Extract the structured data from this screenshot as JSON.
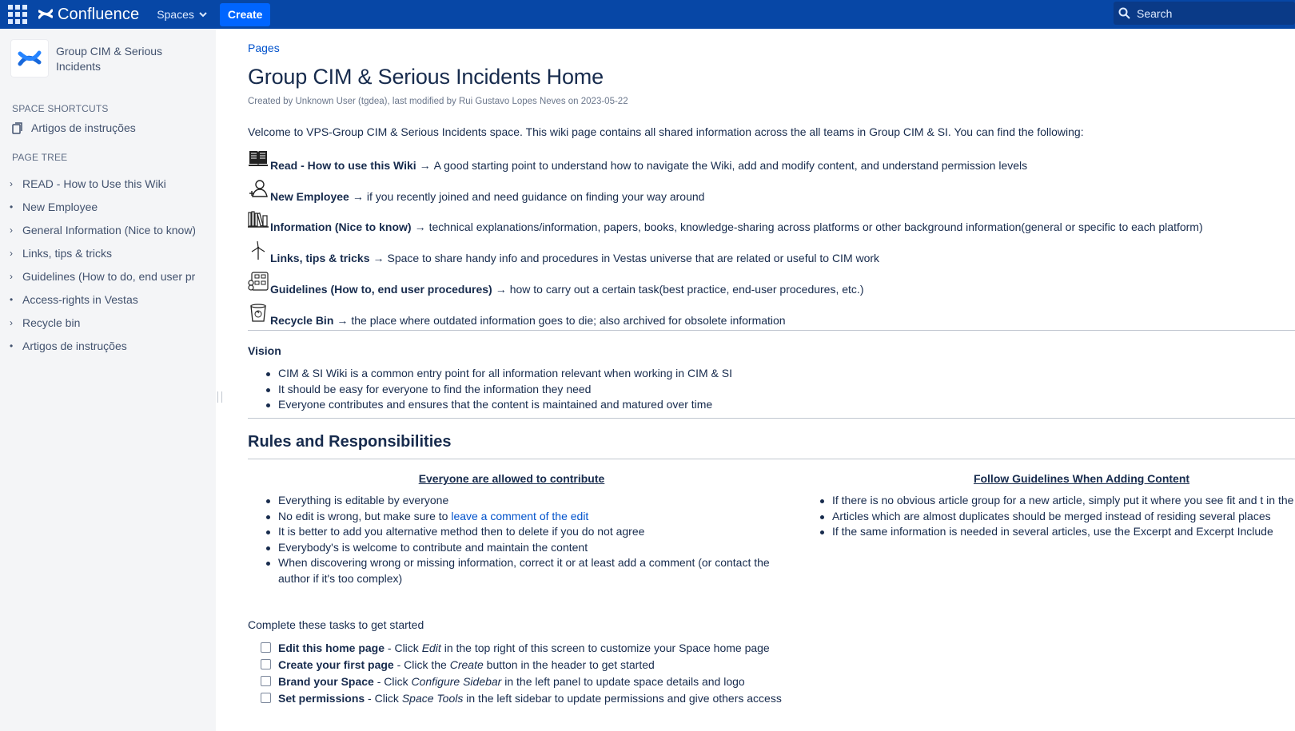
{
  "topbar": {
    "app_name": "Confluence",
    "spaces_label": "Spaces",
    "create_label": "Create",
    "search_placeholder": "Search",
    "bg_color": "#0747a6"
  },
  "sidebar": {
    "space_name": "Group CIM & Serious Incidents",
    "shortcuts_title": "SPACE SHORTCUTS",
    "shortcuts": [
      {
        "label": "Artigos de instruções",
        "icon": "pages-icon"
      }
    ],
    "page_tree_title": "PAGE TREE",
    "tree": [
      {
        "label": "READ - How to Use this Wiki",
        "expandable": true
      },
      {
        "label": "New Employee",
        "expandable": false
      },
      {
        "label": "General Information (Nice to know)",
        "expandable": true
      },
      {
        "label": "Links, tips & tricks",
        "expandable": true
      },
      {
        "label": "Guidelines (How to do, end user pro",
        "expandable": true
      },
      {
        "label": "Access-rights in Vestas",
        "expandable": false
      },
      {
        "label": "Recycle bin",
        "expandable": true
      },
      {
        "label": "Artigos de instruções",
        "expandable": false
      }
    ]
  },
  "main": {
    "breadcrumb": "Pages",
    "title": "Group CIM & Serious Incidents Home",
    "byline": "Created by Unknown User (tgdea), last modified by Rui Gustavo Lopes Neves on 2023-05-22",
    "intro": "Velcome to VPS-Group CIM & Serious Incidents space.  This wiki page contains all shared information across the all teams in Group CIM & SI. You can find the following:",
    "links": [
      {
        "icon": "book-icon",
        "title": "Read - How to use this Wiki",
        "desc": "A good starting point to understand how to navigate the Wiki, add and modify content, and understand permission levels"
      },
      {
        "icon": "person-add-icon",
        "title": "New Employee",
        "desc": "if you recently joined and need guidance on finding your way around"
      },
      {
        "icon": "library-icon",
        "title": "Information (Nice to know)",
        "desc": "technical explanations/information, papers, books, knowledge-sharing across platforms or other background information(general or specific to each platform)"
      },
      {
        "icon": "wind-turbine-icon",
        "title": "Links, tips & tricks",
        "desc": "Space to share handy info and procedures in Vestas universe that are related or useful to CIM work"
      },
      {
        "icon": "flowchart-icon",
        "title": "Guidelines (How to, end user procedures)",
        "desc": "how to carry out a certain task(best practice, end-user procedures, etc.)"
      },
      {
        "icon": "recycle-bin-icon",
        "title": "Recycle Bin",
        "desc": "the place where outdated information goes to die; also archived for obsolete information"
      }
    ],
    "arrow": "→",
    "vision_title": "Vision",
    "vision": [
      "CIM & SI Wiki is a common entry point for all information relevant when working in CIM & SI",
      "It should be easy for everyone to find the information they need",
      "Everyone contributes and ensures that the content is maintained and matured over time"
    ],
    "rules_title": "Rules and Responsibilities",
    "left_col": {
      "title": "Everyone are allowed to contribute",
      "items": [
        {
          "text": "Everything is editable by everyone"
        },
        {
          "text": "No edit is wrong, but make sure to ",
          "link": "leave a comment of the edit"
        },
        {
          "text": "It is better to add you alternative method then to delete if you do not agree"
        },
        {
          "text": "Everybody's is welcome to contribute and maintain the content"
        },
        {
          "text": "When discovering wrong or missing information, correct it or at least add a comment (or contact the author if it's too complex)"
        }
      ]
    },
    "right_col": {
      "title": "Follow Guidelines When Adding Content",
      "items": [
        "If there is no obvious article group for a new article, simply put it where you see fit and t in the comments",
        "Articles which are almost duplicates should be merged instead of residing several places",
        "If the same information is needed in several articles, use the Excerpt and Excerpt Include"
      ]
    },
    "tasks_intro": "Complete these tasks to get started",
    "tasks": [
      {
        "bold": "Edit this home page",
        "pre": " - Click ",
        "em": "Edit",
        "post": " in the top right of this screen to customize your Space home page"
      },
      {
        "bold": "Create your first page",
        "pre": " - Click the ",
        "em": "Create",
        "post": " button in the header to get started"
      },
      {
        "bold": "Brand your Space",
        "pre": " - Click ",
        "em": "Configure Sidebar",
        "post": " in the left panel to update space details and logo"
      },
      {
        "bold": "Set permissions",
        "pre": " - Click ",
        "em": "Space Tools",
        "post": " in the left sidebar to update permissions and give others access"
      }
    ]
  }
}
